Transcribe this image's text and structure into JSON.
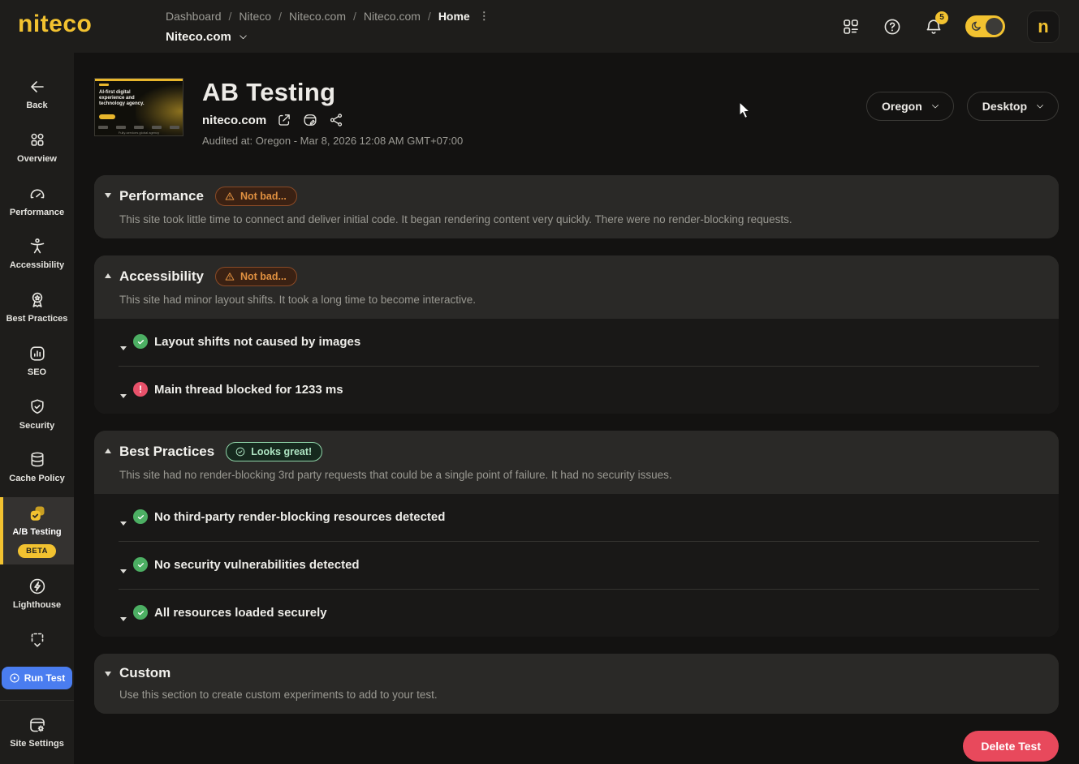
{
  "topbar": {
    "logo": "niteco",
    "breadcrumb": {
      "items": [
        "Dashboard",
        "Niteco",
        "Niteco.com",
        "Niteco.com",
        "Home"
      ],
      "separator": "/"
    },
    "site_selector": "Niteco.com",
    "notifications": {
      "count": "5"
    },
    "avatar_letter": "n"
  },
  "sidebar": {
    "back_label": "Back",
    "items": [
      {
        "label": "Overview"
      },
      {
        "label": "Performance"
      },
      {
        "label": "Accessibility"
      },
      {
        "label": "Best Practices"
      },
      {
        "label": "SEO"
      },
      {
        "label": "Security"
      },
      {
        "label": "Cache Policy"
      },
      {
        "label": "A/B Testing",
        "badge": "BETA",
        "active": true
      },
      {
        "label": "Lighthouse"
      }
    ],
    "run_test_label": "Run Test",
    "site_settings_label": "Site Settings"
  },
  "header": {
    "title": "AB Testing",
    "site": "niteco.com",
    "audited": "Audited at: Oregon - Mar 8, 2026 12:08 AM GMT+07:00",
    "region_dropdown": "Oregon",
    "device_dropdown": "Desktop",
    "thumbnail_text": "AI-first digital experience and technology agency.",
    "thumbnail_caption": "Fully-services global agency"
  },
  "sections": [
    {
      "title": "Performance",
      "badge": "Not bad...",
      "badge_type": "warn",
      "expanded": false,
      "description": "This site took little time to connect and deliver initial code. It began rendering content very quickly. There were no render-blocking requests.",
      "items": []
    },
    {
      "title": "Accessibility",
      "badge": "Not bad...",
      "badge_type": "warn",
      "expanded": true,
      "description": "This site had minor layout shifts. It took a long time to become interactive.",
      "items": [
        {
          "status": "pass",
          "label": "Layout shifts not caused by images"
        },
        {
          "status": "fail",
          "label": "Main thread blocked for 1233 ms"
        }
      ]
    },
    {
      "title": "Best Practices",
      "badge": "Looks great!",
      "badge_type": "good",
      "expanded": true,
      "description": "This site had no render-blocking 3rd party requests that could be a single point of failure. It had no security issues.",
      "items": [
        {
          "status": "pass",
          "label": "No third-party render-blocking resources detected"
        },
        {
          "status": "pass",
          "label": "No security vulnerabilities detected"
        },
        {
          "status": "pass",
          "label": "All resources loaded securely"
        }
      ]
    },
    {
      "title": "Custom",
      "badge": null,
      "expanded": false,
      "description": "Use this section to create custom experiments to add to your test.",
      "items": []
    }
  ],
  "actions": {
    "delete_test_label": "Delete Test"
  },
  "colors": {
    "accent_yellow": "#F2C230",
    "primary_blue": "#4A7DF0",
    "danger_red": "#E8495C",
    "success_green": "#4CAF63",
    "fail_red": "#E8516A",
    "warn_orange": "#E09040",
    "good_green_text": "#AEE4C2"
  }
}
